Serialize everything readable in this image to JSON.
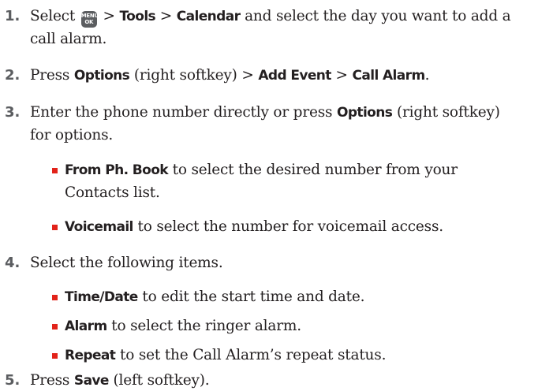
{
  "steps": [
    {
      "number": "1.",
      "line1": {
        "t1": "Select ",
        "key_top": "MENU",
        "key_bottom": "OK",
        "t2": " > ",
        "b1": "Tools",
        "t3": " > ",
        "b2": "Calendar",
        "t4": " and select the day you want to add a"
      },
      "line2": "call alarm."
    },
    {
      "number": "2.",
      "line1": {
        "t1": "Press ",
        "b1": "Options",
        "t2": " (right softkey) > ",
        "b2": "Add Event",
        "t3": " > ",
        "b3": "Call Alarm",
        "t4": "."
      }
    },
    {
      "number": "3.",
      "line1": {
        "t1": "Enter the phone number directly or press ",
        "b1": "Options",
        "t2": " (right softkey)"
      },
      "line2": "for options.",
      "bullets": [
        {
          "bold": "From Ph. Book",
          "text": " to select the desired number from your",
          "cont": "Contacts list."
        },
        {
          "bold": "Voicemail",
          "text": " to select the number for voicemail access."
        }
      ]
    },
    {
      "number": "4.",
      "line1": {
        "t1": "Select the following items."
      },
      "bullets": [
        {
          "bold": "Time/Date",
          "text": " to edit the start time and date."
        },
        {
          "bold": "Alarm",
          "text": " to select the ringer alarm."
        },
        {
          "bold": "Repeat",
          "text": " to set the Call Alarm’s repeat status."
        }
      ]
    },
    {
      "number": "5.",
      "line1": {
        "t1": "Press ",
        "b1": "Save",
        "t2": " (left softkey)."
      }
    }
  ],
  "colors": {
    "text": "#231f20",
    "step_number": "#5b5d60",
    "bullet": "#e2231a",
    "menu_key": "#5b5d60"
  },
  "icons": {
    "menu_ok_key": "menu-ok-key-icon"
  }
}
